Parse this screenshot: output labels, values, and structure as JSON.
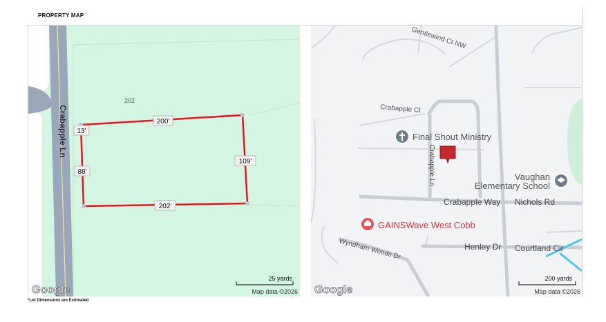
{
  "header": {
    "title": "PROPERTY MAP"
  },
  "lot_map": {
    "road_name": "Crabapple Ln",
    "lot_number": "202",
    "dimensions": {
      "top": "200'",
      "left_top": "13'",
      "left": "88'",
      "right": "109'",
      "bottom": "202'"
    },
    "scale_label": "25 yards",
    "attribution": "Map data ©2026",
    "logo_text": "Google",
    "colors": {
      "lot_fill": "#d3f5e1",
      "road": "#9aa7b8",
      "boundary": "#e8141b"
    }
  },
  "street_map": {
    "streets": [
      "Gentlewind Ct NW",
      "Crabapple Ct",
      "Crabapple Ln",
      "Crabapple Way",
      "Nichols Rd",
      "Wyndham Woods Dr",
      "Henley Dr",
      "Courtland Cir"
    ],
    "places": [
      {
        "name": "Final Shout Ministry",
        "icon": "cross-icon"
      },
      {
        "name": "Vaughan",
        "name2": "Elementary School",
        "icon": "school-icon"
      },
      {
        "name": "GAINSWave West Cobb",
        "icon": "medical-icon"
      }
    ],
    "scale_label": "200 yards",
    "attribution": "Map data ©2026",
    "logo_text": "Google",
    "colors": {
      "marker": "#c6262e",
      "poi_health": "#e8505b",
      "poi_gray": "#6f7b8a"
    }
  },
  "footnote": "*Lot Dimensions are Estimated"
}
